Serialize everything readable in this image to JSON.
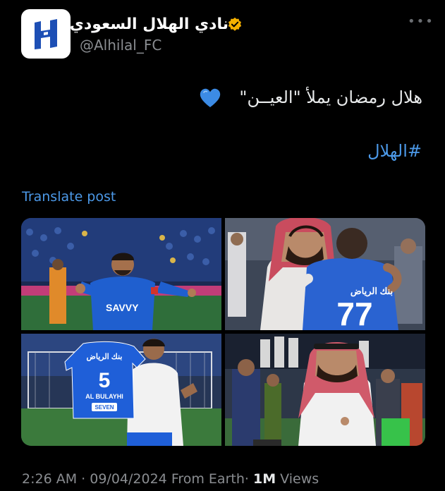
{
  "author": {
    "display_name": "نادي الهلال السعودي",
    "handle": "@Alhilal_FC",
    "avatar_icon": "alhilal-logo-icon",
    "verified_icon": "verified-badge-icon",
    "verified_color": "#f4b000"
  },
  "more_icon": "more-options-icon",
  "tweet": {
    "text": "هلال رمضان يملأ \"العيــن\"",
    "emoji_icon": "blue-heart-icon",
    "hashtag": "#الهلال",
    "translate_label": "Translate post"
  },
  "media": {
    "photos": [
      {
        "name": "player-celebrating-photo",
        "jersey_sponsor": "SAVVY"
      },
      {
        "name": "embrace-photo",
        "jersey_text": "بنك الرياض",
        "jersey_number": "77"
      },
      {
        "name": "jersey-presentation-photo",
        "jersey_text": "بنك الرياض",
        "jersey_number": "5",
        "jersey_name": "AL BULAYHI",
        "jersey_sponsor": "SEVEN"
      },
      {
        "name": "guest-on-pitch-photo"
      }
    ]
  },
  "footer": {
    "time": "2:26 AM",
    "separator": "·",
    "date": "09/04/2024",
    "source": "From Earth",
    "views_count": "1M",
    "views_label": "Views"
  },
  "colors": {
    "background": "#000000",
    "link": "#4c99e8",
    "text": "#e7e9ea",
    "muted": "#8a8d91",
    "brand_blue": "#1d4fb5"
  }
}
